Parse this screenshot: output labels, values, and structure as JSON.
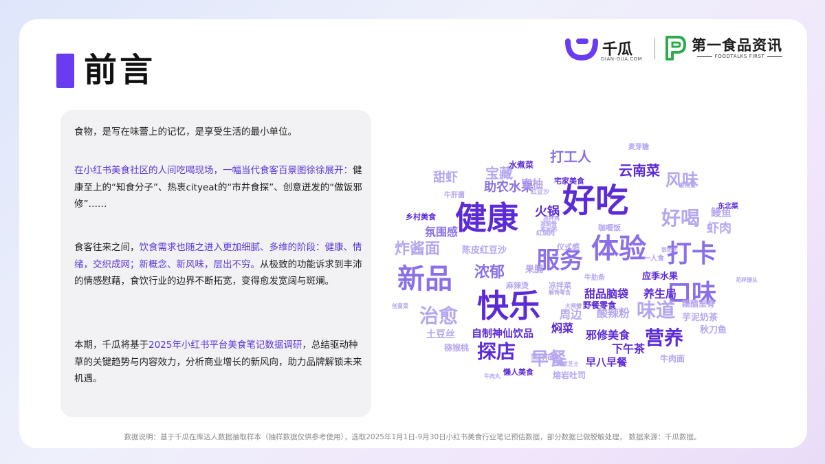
{
  "page": {
    "title": "前言",
    "footer": "数据说明：基于千瓜在库达人数据抽取样本（抽样数据仅供参考使用），选取2025年1月1日-9月30日小红书美食行业笔记预估数据，部分数据已做脱敏处理， 数据来源：千瓜数据。"
  },
  "logos": {
    "qiangua": {
      "name": "千瓜",
      "sub": "DIAN-GUA.COM"
    },
    "foodtalks": {
      "name": "第一食品资讯",
      "sub": "FOODTALKS FIRST"
    }
  },
  "intro": {
    "p1": "食物，是写在味蕾上的记忆，是享受生活的最小单位。",
    "p2_hl": "在小红书美食社区的人间吃喝现场，一幅当代食客百景图徐徐展开：",
    "p2_rest": "健康至上的“知食分子”、热衷cityeat的“市井食探”、创意迸发的“做饭邪修”……",
    "p3_a": "食客往来之间，",
    "p3_hl": "饮食需求也随之进入更加细腻、多维的阶段：健康、情绪，交织成网；新概念、新风味，层出不穷。",
    "p3_rest": "从极致的功能诉求到丰沛的情感慰藉，食饮行业的边界不断拓宽，变得愈发宽阔与斑斓。",
    "p4_a": "本期，千瓜将基于",
    "p4_hl": "2025年小红书平台美食笔记数据调研",
    "p4_rest": "，总结驱动种草的关键趋势与内容效力，分析商业增长的新风向，助力品牌解锁未来机遇。"
  },
  "colors": {
    "accent": "#6a3cf0",
    "dark": "#5b2bd8",
    "mid": "#8a6fe8",
    "light": "#b6a6f0"
  },
  "word_cloud": [
    {
      "t": "好吃",
      "s": 48,
      "c": "dark"
    },
    {
      "t": "健康",
      "s": 46,
      "c": "dark"
    },
    {
      "t": "快乐",
      "s": 46,
      "c": "dark"
    },
    {
      "t": "体验",
      "s": 40,
      "c": "mid"
    },
    {
      "t": "新品",
      "s": 40,
      "c": "mid"
    },
    {
      "t": "服务",
      "s": 34,
      "c": "mid"
    },
    {
      "t": "打卡",
      "s": 36,
      "c": "mid"
    },
    {
      "t": "口味",
      "s": 36,
      "c": "mid"
    },
    {
      "t": "好喝",
      "s": 28,
      "c": "light"
    },
    {
      "t": "风味",
      "s": 24,
      "c": "light"
    },
    {
      "t": "治愈",
      "s": 28,
      "c": "light"
    },
    {
      "t": "探店",
      "s": 28,
      "c": "dark"
    },
    {
      "t": "营养",
      "s": 28,
      "c": "dark"
    },
    {
      "t": "味道",
      "s": 28,
      "c": "light"
    },
    {
      "t": "早餐",
      "s": 26,
      "c": "light"
    },
    {
      "t": "炸酱面",
      "s": 22,
      "c": "light"
    },
    {
      "t": "浓郁",
      "s": 22,
      "c": "mid"
    },
    {
      "t": "打工人",
      "s": 20,
      "c": "mid"
    },
    {
      "t": "宝藏",
      "s": 20,
      "c": "light"
    },
    {
      "t": "云南菜",
      "s": 20,
      "c": "dark"
    },
    {
      "t": "甜虾",
      "s": 18,
      "c": "light"
    },
    {
      "t": "助农水果",
      "s": 18,
      "c": "mid"
    },
    {
      "t": "蜜柚",
      "s": 16,
      "c": "light"
    },
    {
      "t": "火锅",
      "s": 18,
      "c": "dark"
    },
    {
      "t": "氛围感",
      "s": 16,
      "c": "mid"
    },
    {
      "t": "虾肉",
      "s": 18,
      "c": "light"
    },
    {
      "t": "鳗鱼",
      "s": 15,
      "c": "light"
    },
    {
      "t": "甜品脑袋",
      "s": 16,
      "c": "dark"
    },
    {
      "t": "养生局",
      "s": 16,
      "c": "dark"
    },
    {
      "t": "自制神仙饮品",
      "s": 15,
      "c": "dark"
    },
    {
      "t": "酸辣粉",
      "s": 16,
      "c": "light"
    },
    {
      "t": "邪修美食",
      "s": 16,
      "c": "dark"
    },
    {
      "t": "焖菜",
      "s": 16,
      "c": "dark"
    },
    {
      "t": "下午茶",
      "s": 16,
      "c": "dark"
    },
    {
      "t": "早八早餐",
      "s": 15,
      "c": "dark"
    },
    {
      "t": "芋泥奶茶",
      "s": 13,
      "c": "light"
    },
    {
      "t": "秋刀鱼",
      "s": 13,
      "c": "light"
    },
    {
      "t": "周边",
      "s": 16,
      "c": "light"
    },
    {
      "t": "土豆丝",
      "s": 14,
      "c": "light"
    },
    {
      "t": "陈皮红豆沙",
      "s": 13,
      "c": "light"
    },
    {
      "t": "果脯",
      "s": 13,
      "c": "light"
    },
    {
      "t": "应季水果",
      "s": 13,
      "c": "dark"
    },
    {
      "t": "野餐零食",
      "s": 12,
      "c": "dark"
    },
    {
      "t": "糖醋里脊",
      "s": 12,
      "c": "light"
    },
    {
      "t": "牛肉面",
      "s": 12,
      "c": "light"
    },
    {
      "t": "熔岩吐司",
      "s": 12,
      "c": "light"
    },
    {
      "t": "懒人美食",
      "s": 11,
      "c": "dark"
    },
    {
      "t": "猕猴桃",
      "s": 12,
      "c": "light"
    },
    {
      "t": "乡村美食",
      "s": 11,
      "c": "dark"
    },
    {
      "t": "水煮菜",
      "s": 12,
      "c": "dark"
    },
    {
      "t": "宅家美食",
      "s": 11,
      "c": "dark"
    },
    {
      "t": "麦芽糖",
      "s": 10,
      "c": "light"
    },
    {
      "t": "牛肝菌",
      "s": 10,
      "c": "light"
    },
    {
      "t": "东北菜",
      "s": 10,
      "c": "dark"
    },
    {
      "t": "仪式感",
      "s": 11,
      "c": "light"
    },
    {
      "t": "咖喱饭",
      "s": 11,
      "c": "light"
    },
    {
      "t": "麻辣烫",
      "s": 11,
      "c": "light"
    },
    {
      "t": "凉拌菜",
      "s": 11,
      "c": "light"
    },
    {
      "t": "牛肋条",
      "s": 10,
      "c": "light"
    },
    {
      "t": "一人食",
      "s": 10,
      "c": "light"
    },
    {
      "t": "茉莉花茶",
      "s": 10,
      "c": "light"
    },
    {
      "t": "金枪鱼",
      "s": 8,
      "c": "light"
    },
    {
      "t": "红豆沙",
      "s": 9,
      "c": "light"
    },
    {
      "t": "红烧肉",
      "s": 9,
      "c": "light"
    },
    {
      "t": "花样馒头",
      "s": 8,
      "c": "light"
    },
    {
      "t": "创意菜",
      "s": 8,
      "c": "light"
    },
    {
      "t": "大闸蟹",
      "s": 8,
      "c": "light"
    },
    {
      "t": "饭团子",
      "s": 8,
      "c": "light"
    },
    {
      "t": "减脂餐",
      "s": 8,
      "c": "light"
    },
    {
      "t": "牛肉丸",
      "s": 8,
      "c": "light"
    },
    {
      "t": "紫米粥",
      "s": 8,
      "c": "light"
    },
    {
      "t": "解馋零食",
      "s": 8,
      "c": "light"
    },
    {
      "t": "爆浆芝士",
      "s": 8,
      "c": "light"
    },
    {
      "t": "凉拌鸡",
      "s": 8,
      "c": "light"
    }
  ]
}
